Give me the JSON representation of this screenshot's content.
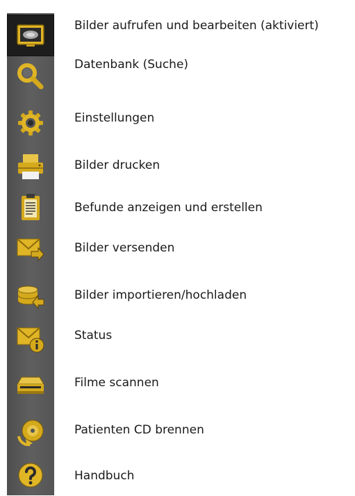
{
  "colors": {
    "toolbar_background": "#555555",
    "active_background": "#1d1d1d",
    "icon_gold": "#d4a91c",
    "label_text": "#1a1a1a"
  },
  "toolbar": {
    "items": [
      {
        "icon": "monitor-icon",
        "active": true
      },
      {
        "icon": "magnifier-icon"
      },
      {
        "icon": "gear-icon"
      },
      {
        "icon": "printer-icon"
      },
      {
        "icon": "clipboard-icon"
      },
      {
        "icon": "mail-send-icon"
      },
      {
        "icon": "database-import-icon"
      },
      {
        "icon": "mail-info-icon"
      },
      {
        "icon": "scanner-icon"
      },
      {
        "icon": "cd-burn-icon"
      },
      {
        "icon": "help-icon"
      }
    ]
  },
  "legend": {
    "items": [
      {
        "label": "Bilder aufrufen und bearbeiten (aktiviert)"
      },
      {
        "label": "Datenbank (Suche)"
      },
      {
        "label": "Einstellungen"
      },
      {
        "label": "Bilder drucken"
      },
      {
        "label": "Befunde anzeigen und erstellen"
      },
      {
        "label": "Bilder versenden"
      },
      {
        "label": "Bilder importieren/hochladen"
      },
      {
        "label": "Status"
      },
      {
        "label": "Filme scannen"
      },
      {
        "label": "Patienten CD brennen"
      },
      {
        "label": "Handbuch"
      }
    ]
  }
}
